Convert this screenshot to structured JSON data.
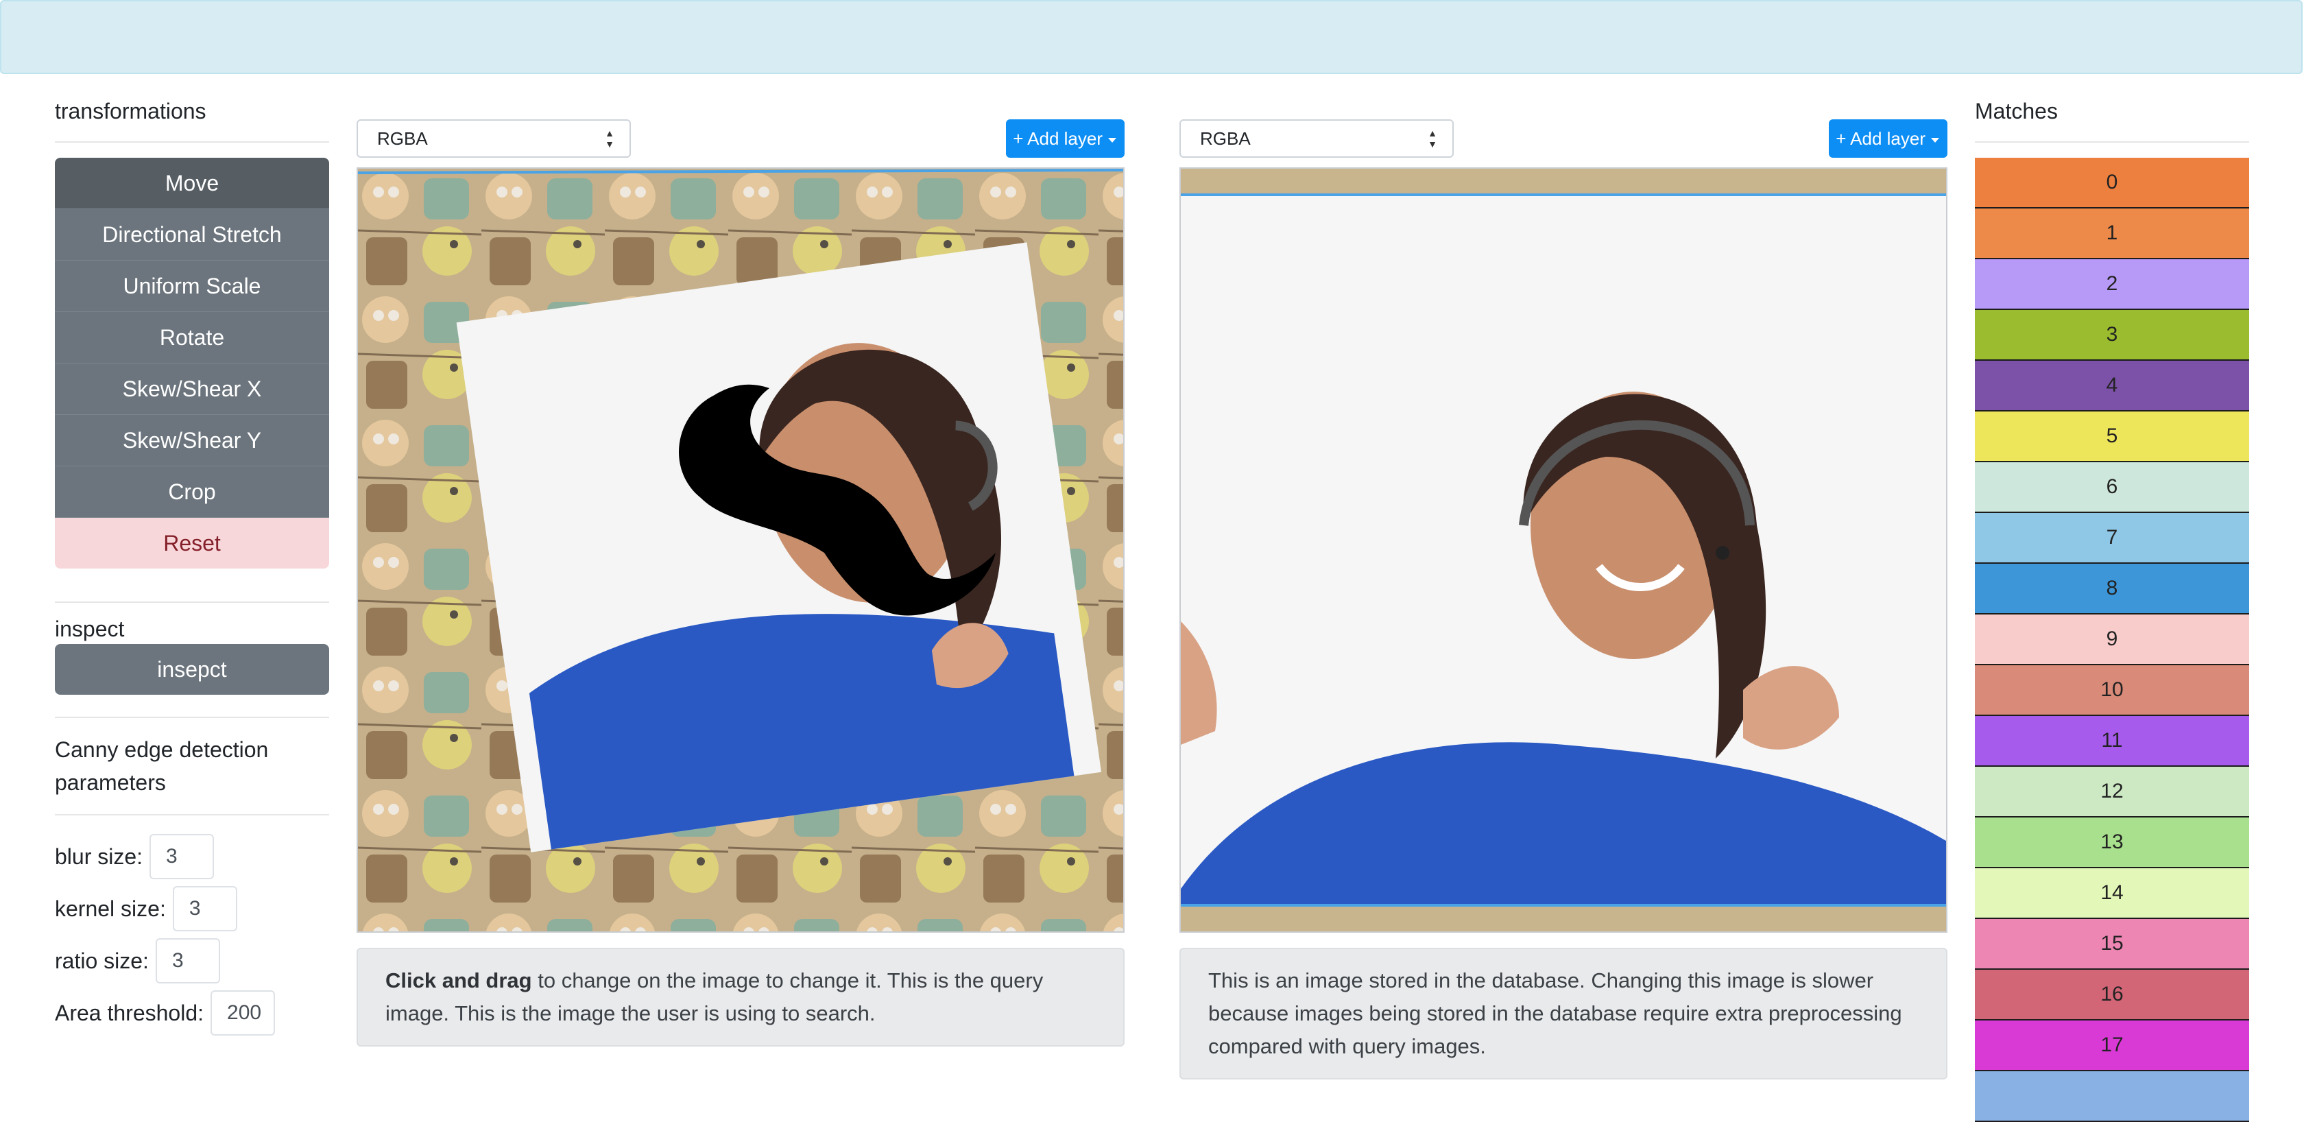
{
  "left": {
    "transformations_title": "transformations",
    "transformations": [
      "Move",
      "Directional Stretch",
      "Uniform Scale",
      "Rotate",
      "Skew/Shear X",
      "Skew/Shear Y",
      "Crop"
    ],
    "reset_label": "Reset",
    "inspect_title": "inspect",
    "inspect_button": "insepct",
    "canny_title": "Canny edge detection parameters",
    "params": [
      {
        "label": "blur size:",
        "value": "3"
      },
      {
        "label": "kernel size:",
        "value": "3"
      },
      {
        "label": "ratio size:",
        "value": "3"
      },
      {
        "label": "Area threshold:",
        "value": "200"
      }
    ]
  },
  "query_panel": {
    "select_value": "RGBA",
    "add_layer": "+ Add layer",
    "caption_bold": "Click and drag",
    "caption_rest": " to change on the image to change it. This is the query image. This is the image the user is using to search."
  },
  "db_panel": {
    "select_value": "RGBA",
    "add_layer": "+ Add layer",
    "caption": "This is an image stored in the database. Changing this image is slower because images being stored in the database require extra preprocessing compared with query images."
  },
  "matches": {
    "title": "Matches",
    "items": [
      {
        "label": "0",
        "color": "#ed7f3f"
      },
      {
        "label": "1",
        "color": "#ed8a4a"
      },
      {
        "label": "2",
        "color": "#b79af7"
      },
      {
        "label": "3",
        "color": "#9abc2e"
      },
      {
        "label": "4",
        "color": "#7b52a8"
      },
      {
        "label": "5",
        "color": "#ede55a"
      },
      {
        "label": "6",
        "color": "#cde7dc"
      },
      {
        "label": "7",
        "color": "#8fc7e6"
      },
      {
        "label": "8",
        "color": "#3c96d8"
      },
      {
        "label": "9",
        "color": "#f8cccb"
      },
      {
        "label": "10",
        "color": "#d98a78"
      },
      {
        "label": "11",
        "color": "#a65bec"
      },
      {
        "label": "12",
        "color": "#cde9c4"
      },
      {
        "label": "13",
        "color": "#a8e08d"
      },
      {
        "label": "14",
        "color": "#e3f8b8"
      },
      {
        "label": "15",
        "color": "#ee86b4"
      },
      {
        "label": "16",
        "color": "#d36676"
      },
      {
        "label": "17",
        "color": "#d93ad6"
      },
      {
        "label": "",
        "color": "#8ab1e4"
      }
    ]
  }
}
